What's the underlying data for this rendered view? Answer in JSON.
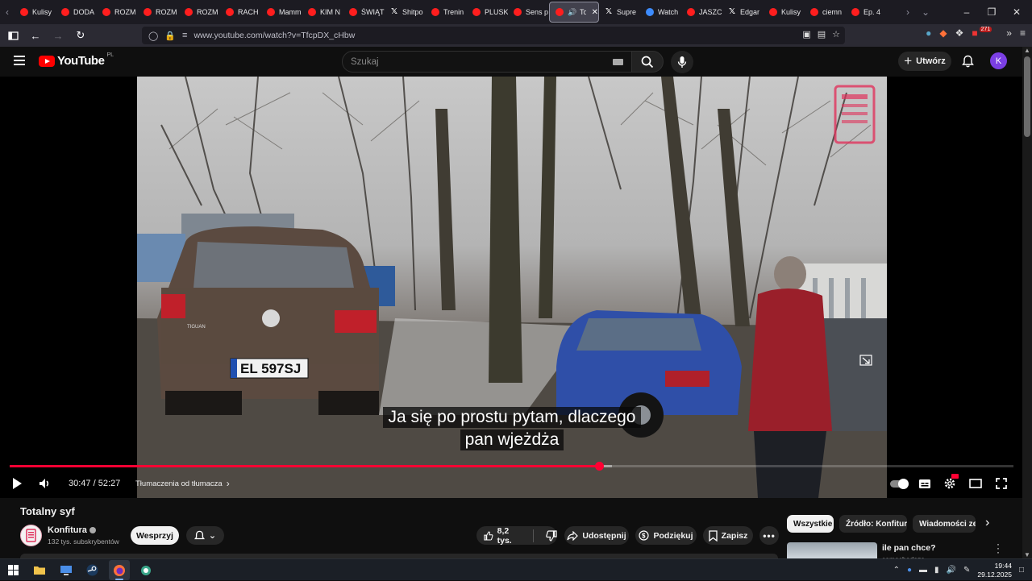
{
  "browser": {
    "tabs": [
      {
        "title": "Kulisy",
        "icon": "youtube-icon"
      },
      {
        "title": "DODA",
        "icon": "youtube-icon"
      },
      {
        "title": "ROZM",
        "icon": "youtube-icon"
      },
      {
        "title": "ROZM",
        "icon": "youtube-icon"
      },
      {
        "title": "ROZM",
        "icon": "youtube-icon"
      },
      {
        "title": "RACH",
        "icon": "youtube-icon"
      },
      {
        "title": "Mamm",
        "icon": "youtube-icon"
      },
      {
        "title": "KIM N",
        "icon": "youtube-icon"
      },
      {
        "title": "ŚWIĄT",
        "icon": "youtube-icon"
      },
      {
        "title": "Shitpo",
        "icon": "x-icon"
      },
      {
        "title": "Trenin",
        "icon": "youtube-icon"
      },
      {
        "title": "PLUSK",
        "icon": "youtube-icon"
      },
      {
        "title": "Sens p",
        "icon": "youtube-icon"
      },
      {
        "title": "Tota",
        "icon": "youtube-icon",
        "active": true
      },
      {
        "title": "Supre",
        "icon": "x-icon"
      },
      {
        "title": "Watch",
        "icon": "watch-icon"
      },
      {
        "title": "JASZC",
        "icon": "youtube-icon"
      },
      {
        "title": "Edgar",
        "icon": "x-icon"
      },
      {
        "title": "Kulisy",
        "icon": "youtube-icon"
      },
      {
        "title": "ciemn",
        "icon": "youtube-icon"
      },
      {
        "title": "Ep. 4",
        "icon": "youtube-icon"
      }
    ],
    "url": "www.youtube.com/watch?v=TfcpDX_cHbw",
    "extension_badge": "271"
  },
  "youtube": {
    "logo_text": "YouTube",
    "region": "PL",
    "search_placeholder": "Szukaj",
    "create_label": "Utwórz",
    "avatar_letter": "K",
    "accent_color": "#ff0033"
  },
  "player": {
    "subtitle_lines": [
      "Ja się po prostu pytam, dlaczego",
      "pan wjeżdża"
    ],
    "current_time": "30:47",
    "duration": "52:27",
    "time_separator": " / ",
    "chapter": "Tłumaczenia od tłumacza",
    "progress_fraction": 0.587,
    "buffered_fraction": 0.6,
    "plate_text": "EL 597SJ",
    "car_brand_text": "TIGUAN"
  },
  "video": {
    "title": "Totalny syf",
    "channel": "Konfitura",
    "subscribers": "132 tys. subskrybentów",
    "support_label": "Wesprzyj",
    "likes": "8,2 tys.",
    "share_label": "Udostępnij",
    "thanks_label": "Podziękuj",
    "save_label": "Zapisz"
  },
  "sidebar": {
    "filters": [
      "Wszystkie",
      "Źródło: Konfitura",
      "Wiadomości ze ś"
    ],
    "recommendation_title": "ile pan chce?",
    "recommendation_channel": "samochodoza"
  },
  "taskbar": {
    "time": "19:44",
    "date": "29.12.2025"
  }
}
